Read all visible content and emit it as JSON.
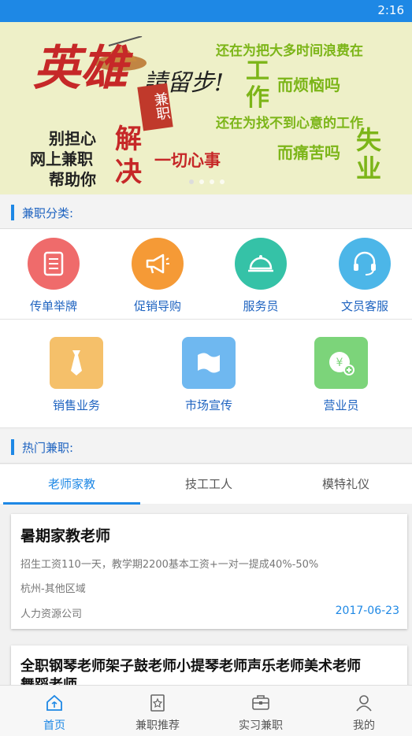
{
  "status_bar": {
    "time": "2:16"
  },
  "banner": {
    "left_title": "英雄",
    "left_script": "請留步!",
    "seal": "兼职",
    "left_line1": "别担心",
    "left_line2": "网上兼职",
    "left_line3": "帮助你",
    "resolve": "解决",
    "all_matters": "一切心事",
    "right_line1": "还在为把大多时间浪费在",
    "work_vertical": "工作",
    "annoyed": "而烦恼吗",
    "right_line2": "还在为找不到心意的工作",
    "suffer": "而痛苦吗",
    "unemployed_vertical": "失业",
    "slides": 4,
    "active_slide": 1
  },
  "categories_section": {
    "label": "兼职分类:"
  },
  "categories": [
    {
      "label": "传单举牌",
      "icon": "flyer-icon",
      "color": "#ef6b6b"
    },
    {
      "label": "促销导购",
      "icon": "megaphone-icon",
      "color": "#f59a36"
    },
    {
      "label": "服务员",
      "icon": "cloche-icon",
      "color": "#35c2a7"
    },
    {
      "label": "文员客服",
      "icon": "headset-icon",
      "color": "#4cb6e8"
    },
    {
      "label": "销售业务",
      "icon": "tie-icon",
      "color": "#f5c06a"
    },
    {
      "label": "市场宣传",
      "icon": "flag-icon",
      "color": "#6fb8f0"
    },
    {
      "label": "营业员",
      "icon": "yuan-icon",
      "color": "#7cd47a"
    }
  ],
  "hot_section": {
    "label": "热门兼职:"
  },
  "tabs": [
    {
      "label": "老师家教",
      "active": true
    },
    {
      "label": "技工工人",
      "active": false
    },
    {
      "label": "模特礼仪",
      "active": false
    }
  ],
  "jobs": [
    {
      "title": "暑期家教老师",
      "desc": "招生工资110一天，教学期2200基本工资+一对一提成40%-50%",
      "location": "杭州-其他区域",
      "company": "人力资源公司",
      "date": "2017-06-23"
    },
    {
      "title_line1": "全职钢琴老师架子鼓老师小提琴老师声乐老师美术老师",
      "title_line2": "舞蹈老师"
    }
  ],
  "bottom_nav": [
    {
      "label": "首页",
      "icon": "home-icon",
      "active": true
    },
    {
      "label": "兼职推荐",
      "icon": "recommend-icon",
      "active": false
    },
    {
      "label": "实习兼职",
      "icon": "briefcase-icon",
      "active": false
    },
    {
      "label": "我的",
      "icon": "profile-icon",
      "active": false
    }
  ],
  "colors": {
    "accent": "#1e88e5",
    "banner_bg": "#eef0c8",
    "banner_red": "#c62828",
    "banner_green": "#7cb518"
  }
}
